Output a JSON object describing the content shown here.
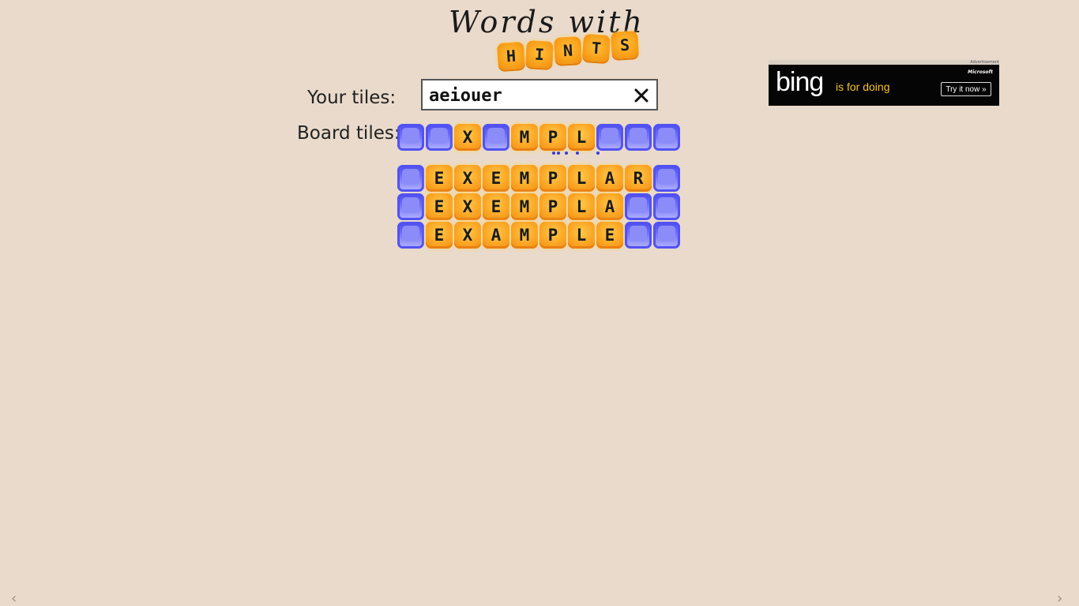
{
  "logo": {
    "script": "Words with",
    "tiles": [
      "H",
      "I",
      "N",
      "T",
      "S"
    ]
  },
  "your_tiles": {
    "label": "Your tiles:",
    "value": "aeiouer"
  },
  "board_tiles": {
    "label": "Board tiles:",
    "tiles": [
      "",
      "",
      "X",
      "",
      "M",
      "P",
      "L",
      "",
      "",
      ""
    ]
  },
  "results": [
    [
      "",
      "E",
      "X",
      "E",
      "M",
      "P",
      "L",
      "A",
      "R",
      ""
    ],
    [
      "",
      "E",
      "X",
      "E",
      "M",
      "P",
      "L",
      "A",
      "",
      ""
    ],
    [
      "",
      "E",
      "X",
      "A",
      "M",
      "P",
      "L",
      "E",
      "",
      ""
    ]
  ],
  "ad": {
    "label": "Advertisement",
    "sponsor": "Microsoft",
    "brand": "bing",
    "tagline": "is for doing",
    "cta": "Try it now »"
  },
  "icons": {
    "clear": "close-icon",
    "back": "chevron-left-icon",
    "forward": "chevron-right-icon"
  },
  "nav": {
    "back": "‹",
    "forward": "›"
  },
  "colors": {
    "background": "#e9dacb",
    "tile_orange": "#f9a31c",
    "tile_blue": "#5252f2"
  }
}
